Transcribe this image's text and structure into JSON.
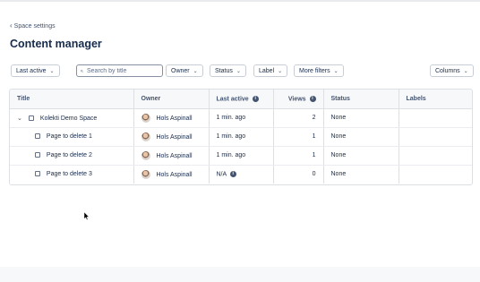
{
  "breadcrumb": {
    "back_label": "Space settings"
  },
  "page_title": "Content manager",
  "filters": {
    "last_active": "Last active",
    "search_placeholder": "Search by title",
    "owner": "Owner",
    "status": "Status",
    "label": "Label",
    "more_filters": "More filters",
    "columns": "Columns"
  },
  "table": {
    "headers": {
      "title": "Title",
      "owner": "Owner",
      "last_active": "Last active",
      "views": "Views",
      "status": "Status",
      "labels": "Labels"
    },
    "rows": [
      {
        "title": "Kolekti Demo Space",
        "owner": "Hols Aspinall",
        "last_active": "1 min. ago",
        "views": "2",
        "status": "None",
        "labels": ""
      },
      {
        "title": "Page to delete 1",
        "owner": "Hols Aspinall",
        "last_active": "1 min. ago",
        "views": "1",
        "status": "None",
        "labels": ""
      },
      {
        "title": "Page to delete 2",
        "owner": "Hols Aspinall",
        "last_active": "1 min. ago",
        "views": "1",
        "status": "None",
        "labels": ""
      },
      {
        "title": "Page to delete 3",
        "owner": "Hols Aspinall",
        "last_active": "N/A",
        "views": "0",
        "status": "None",
        "labels": ""
      }
    ]
  }
}
